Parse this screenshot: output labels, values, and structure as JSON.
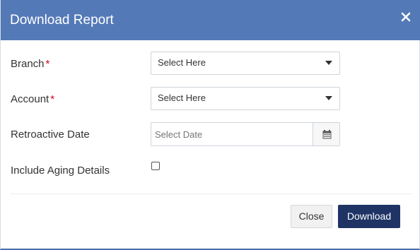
{
  "dialog": {
    "title": "Download Report",
    "close_icon": "close-icon",
    "header_color": "#5479b7"
  },
  "form": {
    "branch": {
      "label": "Branch",
      "required_mark": "*",
      "value": "Select Here"
    },
    "account": {
      "label": "Account",
      "required_mark": "*",
      "value": "Select Here"
    },
    "retroactive_date": {
      "label": "Retroactive Date",
      "placeholder": "Select Date",
      "icon": "calendar-icon"
    },
    "include_aging": {
      "label": "Include Aging Details",
      "checked": false
    }
  },
  "footer": {
    "close_label": "Close",
    "download_label": "Download",
    "download_color": "#1f3465"
  }
}
